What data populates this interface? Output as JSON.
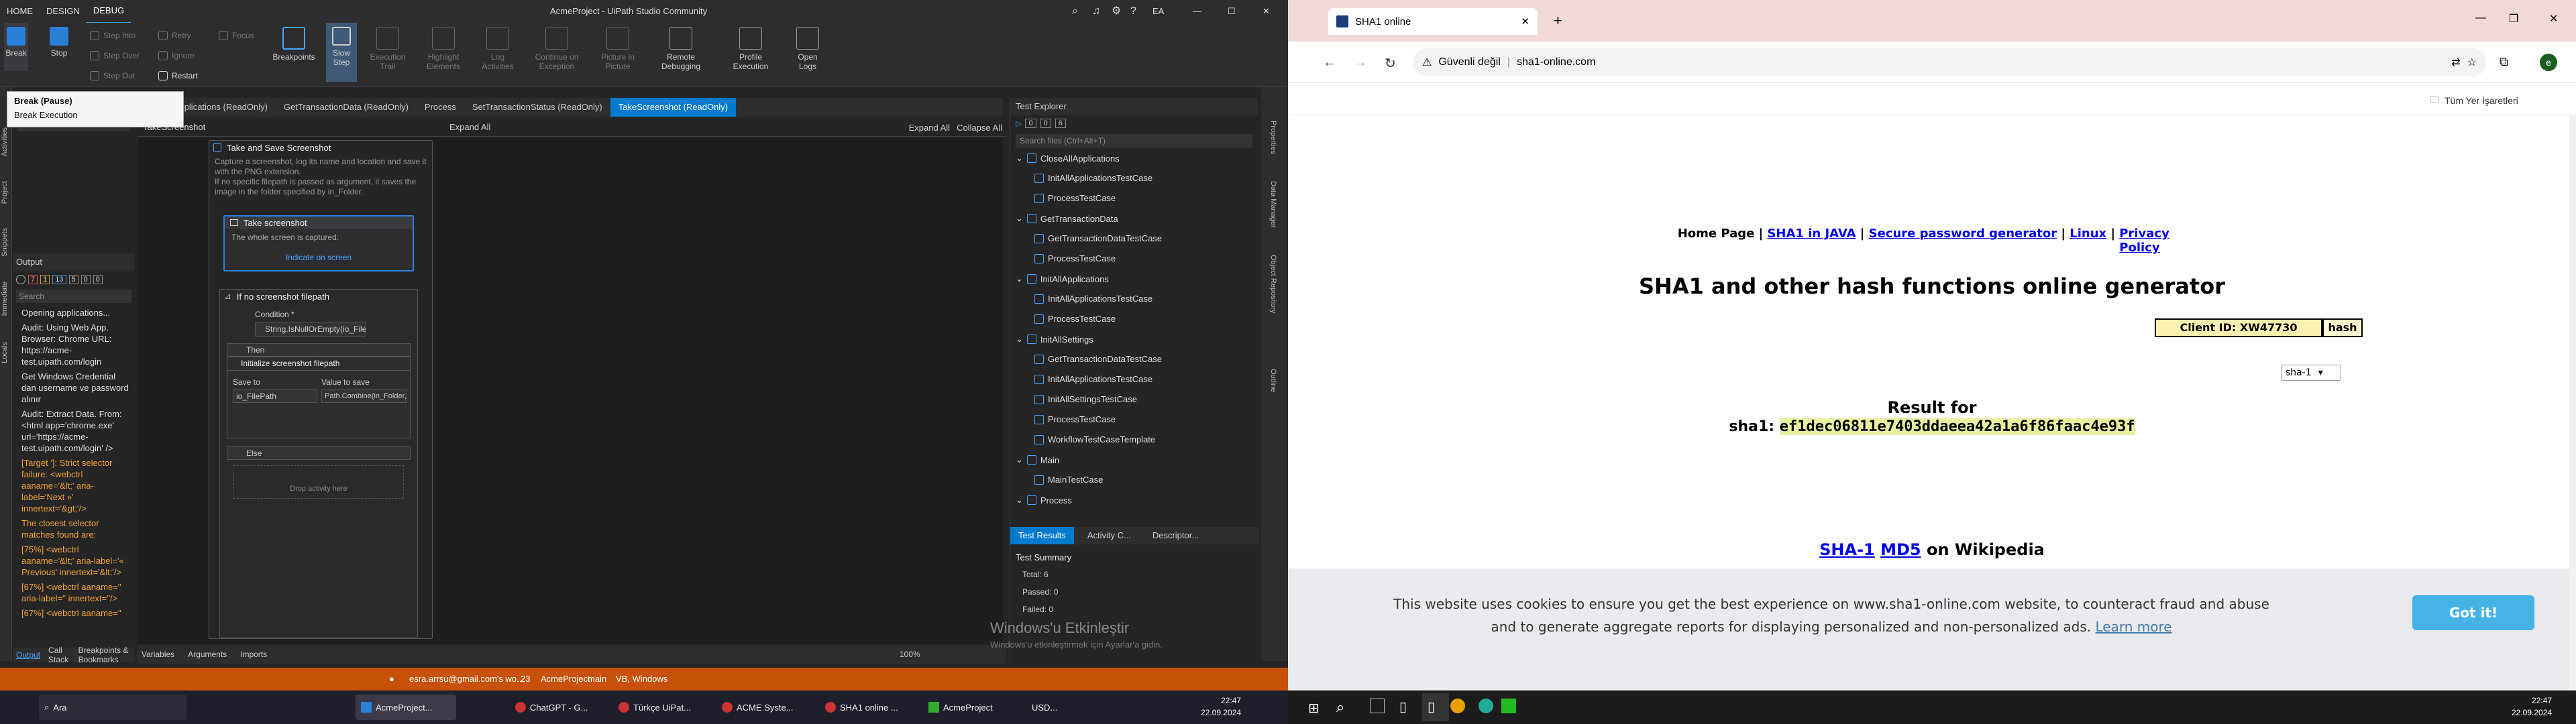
{
  "left_window": {
    "title": "AcmeProject - UiPath Studio Community",
    "menu_tabs": [
      "HOME",
      "DESIGN",
      "DEBUG"
    ],
    "account": "EA",
    "ribbon": {
      "break": "Break",
      "stop": "Stop",
      "step_into": "Step Into",
      "step_over": "Step Over",
      "step_out": "Step Out",
      "retry": "Retry",
      "ignore": "Ignore",
      "restart": "Restart",
      "focus": "Focus",
      "breakpoints": "Breakpoints",
      "slow_step_1": "Slow",
      "slow_step_2": "Step",
      "execution_trail_1": "Execution",
      "execution_trail_2": "Trail",
      "highlight_1": "Highlight",
      "highlight_2": "Elements",
      "log_1": "Log",
      "log_2": "Activities",
      "continue_1": "Continue on",
      "continue_2": "Exception",
      "picture_1": "Picture in",
      "picture_2": "Picture",
      "remote_1": "Remote",
      "remote_2": "Debugging",
      "profile_1": "Profile",
      "profile_2": "Execution",
      "open_logs_1": "Open",
      "open_logs_2": "Logs"
    },
    "tooltip": {
      "title": "Break (Pause)",
      "body": "Break Execution"
    },
    "left_panel_add": "Add...",
    "side_tabs": [
      "Activities",
      "Project",
      "Snippets",
      "Immediate",
      "Locals"
    ],
    "output": {
      "title": "Output",
      "counts": [
        "7",
        "1",
        "13",
        "5",
        "0",
        "0"
      ],
      "search_placeholder": "Search",
      "lines": [
        {
          "text": "Opening applications...",
          "err": false
        },
        {
          "text": "Audit: Using Web App. Browser: Chrome URL: https://acme-test.uipath.com/login",
          "err": false
        },
        {
          "text": "Get Windows Credential dan username ve password alınır",
          "err": false
        },
        {
          "text": "Audit: Extract Data. From: <html app='chrome.exe' url='https://acme-test.uipath.com/login' />",
          "err": false
        },
        {
          "text": "[Target ']: Strict selector failure: <webctrl aaname='&lt;' aria-label='Next »' innertext='&gt;'/>",
          "err": true
        },
        {
          "text": "The closest selector matches found are:",
          "err": true
        },
        {
          "text": "[75%] <webctrl aaname='&lt;' aria-label='« Previous' innertext='&lt;'/>",
          "err": true
        },
        {
          "text": "[67%] <webctrl aaname='' aria-label='' innertext=''/>",
          "err": true
        },
        {
          "text": "[67%] <webctrl aaname='' aria-label='' innertext=''/>",
          "err": true
        },
        {
          "text": "[67%] <webctrl aaname='' aria-label='' innertext=''/>",
          "err": true
        }
      ],
      "bottom_tabs": [
        "Output",
        "Call Stack",
        "Breakpoints & Bookmarks"
      ]
    },
    "doc_tabs": [
      "InitAllApplications (ReadOnly)",
      "GetTransactionData (ReadOnly)",
      "Process",
      "SetTransactionStatus (ReadOnly)",
      "TakeScreenshot (ReadOnly)"
    ],
    "breadcrumb": "TakeScreenshot",
    "expand_all": "Expand All",
    "collapse_all": "Collapse All",
    "designer": {
      "sequence_title": "Take and Save Screenshot",
      "sequence_desc": "Capture a screenshot, log its name and location and save it with the PNG extension.\nIf no specific filepath is passed as argument, it saves the image in the folder specified by in_Folder.",
      "take_title": "Take screenshot",
      "take_desc": "The whole screen is captured.",
      "indicate": "Indicate on screen",
      "if_title": "If no screenshot filepath",
      "condition_label": "Condition *",
      "condition_value": "String.IsNullOrEmpty(io_FilePath)",
      "then_label": "Then",
      "init_title": "Initialize screenshot filepath",
      "save_to_label": "Save to",
      "save_to_value": "io_FilePath",
      "value_label": "Value to save",
      "value_value": "Path.Combine(in_Folder, \"Exceptic",
      "else_label": "Else",
      "drop_here": "Drop activity here"
    },
    "designer_bottom_tabs": [
      "Variables",
      "Arguments",
      "Imports"
    ],
    "zoom": "100%",
    "test_explorer": {
      "title": "Test Explorer",
      "counts": [
        "0",
        "0",
        "6"
      ],
      "search_placeholder": "Search files (Ctrl+Alt+T)",
      "items": [
        {
          "label": "CloseAllApplications",
          "level": 0
        },
        {
          "label": "InitAllApplicationsTestCase",
          "level": 1
        },
        {
          "label": "ProcessTestCase",
          "level": 1
        },
        {
          "label": "GetTransactionData",
          "level": 0
        },
        {
          "label": "GetTransactionDataTestCase",
          "level": 1
        },
        {
          "label": "ProcessTestCase",
          "level": 1
        },
        {
          "label": "InitAllApplications",
          "level": 0
        },
        {
          "label": "InitAllApplicationsTestCase",
          "level": 1
        },
        {
          "label": "ProcessTestCase",
          "level": 1
        },
        {
          "label": "InitAllSettings",
          "level": 0
        },
        {
          "label": "GetTransactionDataTestCase",
          "level": 1
        },
        {
          "label": "InitAllApplicationsTestCase",
          "level": 1
        },
        {
          "label": "InitAllSettingsTestCase",
          "level": 1
        },
        {
          "label": "ProcessTestCase",
          "level": 1
        },
        {
          "label": "WorkflowTestCaseTemplate",
          "level": 1
        },
        {
          "label": "Main",
          "level": 0
        },
        {
          "label": "MainTestCase",
          "level": 1
        },
        {
          "label": "Process",
          "level": 0
        }
      ],
      "tabs": [
        "Test Results",
        "Activity C...",
        "Descriptor..."
      ],
      "summary_title": "Test Summary",
      "total": "Total: 6",
      "passed": "Passed: 0",
      "failed": "Failed: 0"
    },
    "right_side_tabs": [
      "Properties",
      "Data Manager",
      "Object Repository",
      "Outline"
    ],
    "watermark_1": "Windows'u Etkinleştir",
    "watermark_2": "Windows'u etkinleştirmek için Ayarlar'a gidin.",
    "status": {
      "email": "esra.arrsu@gmail.com's wo...",
      "count": "23",
      "project": "AcmeProject",
      "branch": "main",
      "lang": "VB, Windows"
    },
    "taskbar": {
      "search": "Ara",
      "apps": [
        "AcmeProject...",
        "ChatGPT - G...",
        "Türkçe UiPat...",
        "ACME Syste...",
        "SHA1 online ...",
        "AcmeProject"
      ],
      "weather": "USD...",
      "time": "22:47",
      "date": "22.09.2024"
    }
  },
  "right_window": {
    "tab_title": "SHA1 online",
    "security": "Güvenli değil",
    "url": "sha1-online.com",
    "avatar": "e",
    "bookmarks": "Tüm Yer İşaretleri",
    "nav": {
      "home": "Home Page",
      "sep": "|",
      "java": "SHA1 in JAVA",
      "password": "Secure password generator",
      "linux": "Linux",
      "privacy": "Privacy Policy"
    },
    "heading": "SHA1 and other hash functions online generator",
    "input_value": "Client ID: XW47730",
    "hash_button": "hash",
    "algo": "sha-1",
    "result_label": "Result for",
    "result_prefix": "sha1:",
    "result_hash": "ef1dec06811e7403ddaeea42a1a6f86faac4e93f",
    "wiki_sha": "SHA-1",
    "wiki_md5": "MD5",
    "wiki_suffix": "on Wikipedia",
    "cookie_text_1": "This website uses cookies to ensure you get the best experience on www.sha1-online.com website, to counteract fraud and abuse",
    "cookie_text_2": "and to generate aggregate reports for displaying personalized and non-personalized ads.",
    "learn_more": "Learn more",
    "got_it": "Got it!",
    "taskbar": {
      "time": "22:47",
      "date": "22.09.2024"
    }
  }
}
